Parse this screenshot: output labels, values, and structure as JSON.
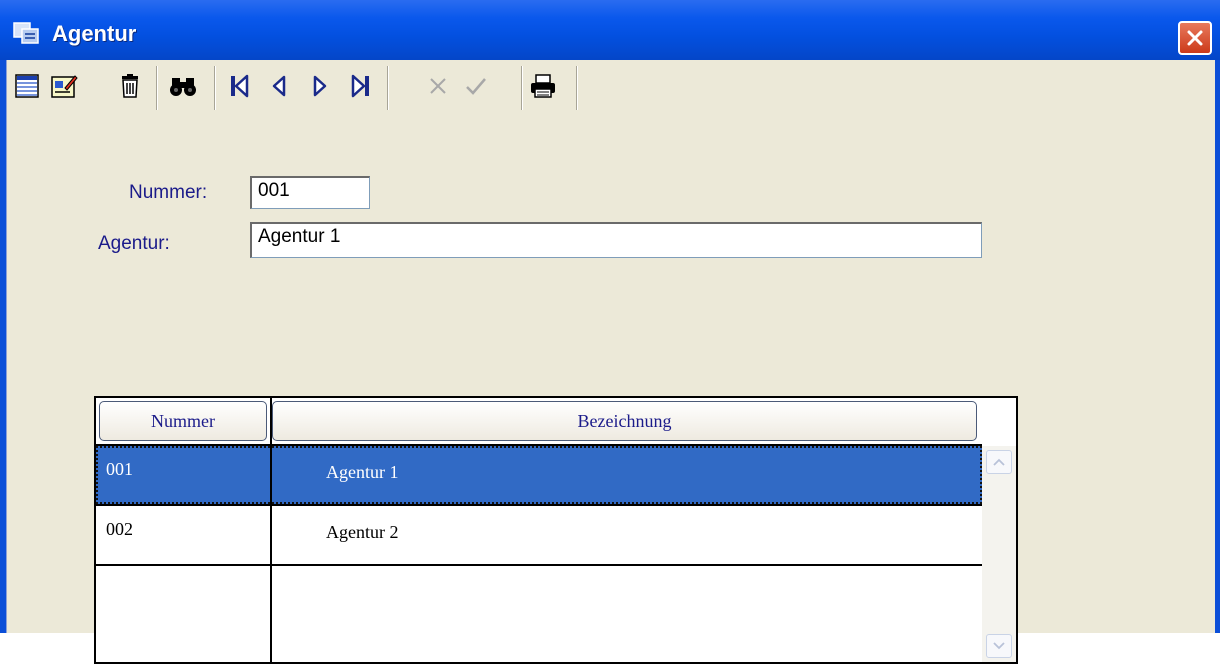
{
  "window": {
    "title": "Agentur"
  },
  "toolbar": {
    "buttons": [
      {
        "name": "new-record",
        "icon": "list-icon"
      },
      {
        "name": "edit-record",
        "icon": "edit-icon"
      },
      {
        "name": "delete-record",
        "icon": "trash-icon"
      },
      {
        "name": "search",
        "icon": "binoculars-icon"
      },
      {
        "name": "first-record",
        "icon": "first-icon"
      },
      {
        "name": "previous-record",
        "icon": "previous-icon"
      },
      {
        "name": "next-record",
        "icon": "next-icon"
      },
      {
        "name": "last-record",
        "icon": "last-icon"
      },
      {
        "name": "cancel",
        "icon": "cancel-icon",
        "enabled": false
      },
      {
        "name": "confirm",
        "icon": "checkmark-icon",
        "enabled": false
      },
      {
        "name": "print",
        "icon": "printer-icon"
      }
    ]
  },
  "form": {
    "number_label": "Nummer:",
    "number_value": "001",
    "agency_label": "Agentur:",
    "agency_value": "Agentur 1"
  },
  "grid": {
    "columns": [
      "Nummer",
      "Bezeichnung"
    ],
    "rows": [
      {
        "nummer": "001",
        "bezeichnung": "Agentur 1",
        "selected": true
      },
      {
        "nummer": "002",
        "bezeichnung": "Agentur 2",
        "selected": false
      }
    ]
  },
  "colors": {
    "titlebar": "#0350e0",
    "client_background": "#ece9d8",
    "selection": "#316ac5",
    "label_text": "#1b1b8a"
  }
}
